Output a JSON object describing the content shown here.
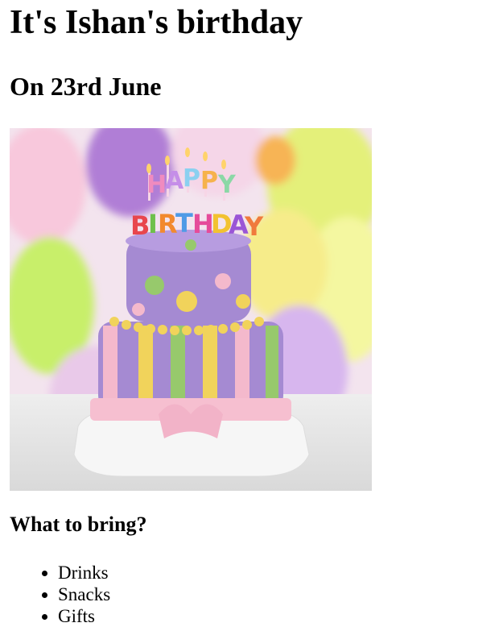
{
  "page": {
    "title": "It's Ishan's birthday",
    "date_heading": "On 23rd June"
  },
  "image": {
    "alt": "Birthday cake",
    "cake_topper": "HAPPY BIRTHDAY",
    "colors": {
      "lavender": "#a58ad2",
      "pink": "#f4b9cc",
      "yellow": "#f1d35b",
      "green": "#97c96c"
    }
  },
  "bring": {
    "heading": "What to bring?",
    "items": [
      "Drinks",
      "Snacks",
      "Gifts"
    ]
  }
}
